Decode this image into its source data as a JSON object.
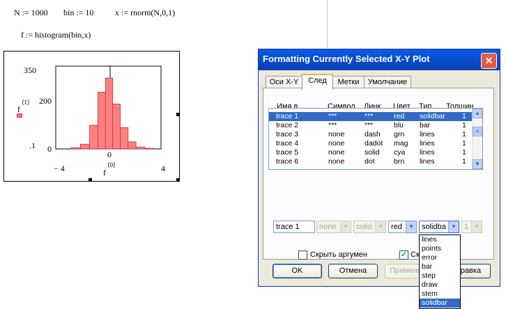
{
  "worksheet": {
    "def_n": "N := 1000",
    "def_bin": "bin := 10",
    "def_x": "x := rnorm(N,0,1)",
    "def_f": "f := histogram(bin,x)",
    "plot": {
      "y_label": "f",
      "y_label_sup": "⟨1⟩",
      "x_label": "f",
      "x_label_sup": "⟨0⟩",
      "marker_text": ".1",
      "ytick_top": "350",
      "ytick_mid": "200",
      "ytick_bottom": "0",
      "xtick_left": "− 4",
      "xtick_mid": "0",
      "xtick_right": "4",
      "bar_color": "#ff8080"
    }
  },
  "chart_data": {
    "type": "bar",
    "title": "",
    "xlabel": "f⟨0⟩",
    "ylabel": "f⟨1⟩",
    "xlim": [
      -4,
      4
    ],
    "ylim": [
      0,
      350
    ],
    "x": [
      -2.5,
      -1.75,
      -1.1,
      -0.5,
      0.05,
      0.6,
      1.2,
      1.8,
      2.4,
      3.1
    ],
    "values": [
      5,
      20,
      100,
      240,
      300,
      190,
      90,
      30,
      8,
      3
    ]
  },
  "dialog": {
    "title": "Formatting Currently Selected X-Y Plot",
    "close_glyph": "✕",
    "tabs": [
      {
        "label": "Оси X-Y"
      },
      {
        "label": "След"
      },
      {
        "label": "Метки"
      },
      {
        "label": "Умолчание"
      }
    ],
    "columns": {
      "name": "Имя в",
      "symbol": "Символ",
      "line": "Линк",
      "color": "Цвет",
      "type": "Тип",
      "weight": "Толщин"
    },
    "traces": [
      {
        "name": "trace 1",
        "symbol": "***",
        "line": "***",
        "color": "red",
        "type": "solidbar",
        "weight": "1"
      },
      {
        "name": "trace 2",
        "symbol": "***",
        "line": "***",
        "color": "blu",
        "type": "bar",
        "weight": "1"
      },
      {
        "name": "trace 3",
        "symbol": "none",
        "line": "dash",
        "color": "grn",
        "type": "lines",
        "weight": "1"
      },
      {
        "name": "trace 4",
        "symbol": "none",
        "line": "dadot",
        "color": "mag",
        "type": "lines",
        "weight": "1"
      },
      {
        "name": "trace 5",
        "symbol": "none",
        "line": "solid",
        "color": "cya",
        "type": "lines",
        "weight": "1"
      },
      {
        "name": "trace 6",
        "symbol": "none",
        "line": "dot",
        "color": "brn",
        "type": "lines",
        "weight": "1"
      }
    ],
    "edit": {
      "name_value": "trace 1",
      "symbol_value": "none",
      "line_value": "solid",
      "color_value": "red",
      "type_value": "solidba",
      "weight_value": "1"
    },
    "type_options": [
      "lines",
      "points",
      "error",
      "bar",
      "step",
      "draw",
      "stem",
      "solidbar"
    ],
    "check_hide_args": "Скрыть аргумен",
    "check_second_fragment": "Ск",
    "buttons": {
      "ok": "OK",
      "cancel": "Отмена",
      "apply": "Применить",
      "help": "Справка"
    },
    "accent_color": "#316ac5"
  }
}
